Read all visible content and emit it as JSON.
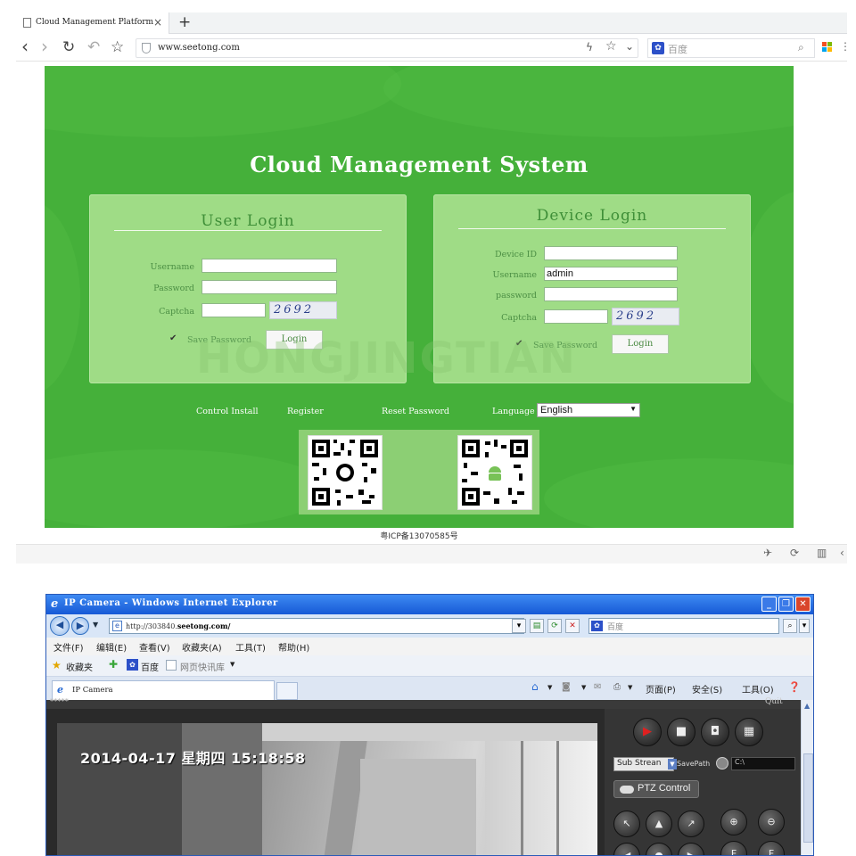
{
  "top_browser": {
    "tab_title": "Cloud Management Platform",
    "tab_close": "×",
    "new_tab": "+",
    "nav": {
      "back": "‹",
      "forward": "›",
      "reload": "↻",
      "undo": "↶",
      "bookmark": "☆"
    },
    "url": "www.seetong.com",
    "search_placeholder": "百度",
    "icons": {
      "shield": "shield-icon",
      "bolt": "bolt-icon",
      "star": "star-icon",
      "search": "search-icon",
      "windows": "windows-logo-icon"
    }
  },
  "login_page": {
    "title": "Cloud Management System",
    "watermark": "HONGJINGTIAN",
    "user_login": {
      "heading": "User Login",
      "fields": [
        {
          "label": "Username",
          "value": ""
        },
        {
          "label": "Password",
          "value": ""
        },
        {
          "label": "Captcha",
          "value": ""
        }
      ],
      "captcha_text": "2692",
      "save_password": "Save Password",
      "save_checked": true,
      "login_button": "Login"
    },
    "device_login": {
      "heading": "Device Login",
      "fields": [
        {
          "label": "Device ID",
          "value": ""
        },
        {
          "label": "Username",
          "value": "admin"
        },
        {
          "label": "password",
          "value": ""
        },
        {
          "label": "Captcha",
          "value": ""
        }
      ],
      "captcha_text": "2692",
      "save_password": "Save Password",
      "save_checked": true,
      "login_button": "Login"
    },
    "links": {
      "control_install": "Control Install",
      "register": "Register",
      "reset_password": "Reset Password",
      "language_label": "Language"
    },
    "language_value": "English",
    "footer": "粤ICP备13070585号",
    "colors": {
      "background": "#45b03a",
      "panel": "#9fdc86",
      "heading": "#3f8f38"
    }
  },
  "ie_browser": {
    "window_title": "IP Camera - Windows Internet Explorer",
    "url_prefix": "http://303840.",
    "url_domain": "seetong.com/",
    "search_placeholder": "百度",
    "menu": [
      "文件(F)",
      "编辑(E)",
      "查看(V)",
      "收藏夹(A)",
      "工具(T)",
      "帮助(H)"
    ],
    "favorites": {
      "label": "收藏夹",
      "baidu": "百度",
      "gallery": "网页快讯库"
    },
    "tab_title": "IP Camera",
    "commands": {
      "page": "页面(P)",
      "safety": "安全(S)",
      "tools": "工具(O)"
    },
    "camera": {
      "top_label": "*****",
      "quit": "Quit",
      "osd": "2014-04-17 星期四 15:18:58",
      "stream": "Sub Strean",
      "save_path_label": "SavePath",
      "save_path_value": "C:\\",
      "ptz_label": "PTZ Control"
    }
  }
}
